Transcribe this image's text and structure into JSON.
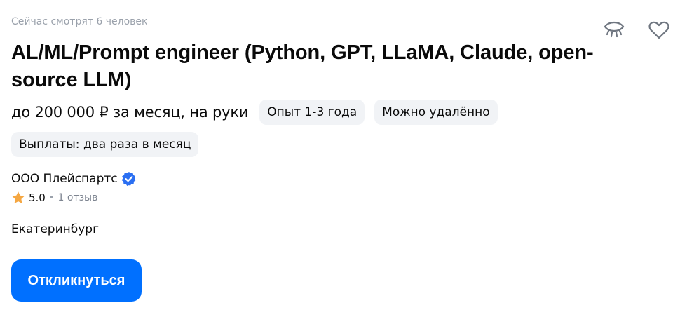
{
  "header": {
    "viewers_text": "Сейчас смотрят 6 человек",
    "title": "AL/ML/Prompt engineer (Python, GPT, LLaMA, Claude, open-source LLM)",
    "icons": [
      "eye-hide-icon",
      "heart-icon"
    ]
  },
  "offer": {
    "salary": "до 200 000 ₽ за месяц, на руки",
    "experience": "Опыт 1-3 года",
    "remote": "Можно удалённо",
    "payouts": "Выплаты: два раза в месяц"
  },
  "company": {
    "name": "ООО Плейспартс",
    "verified_icon": "verified-badge-icon",
    "rating": "5.0",
    "reviews": "1 отзыв"
  },
  "location": {
    "city": "Екатеринбург"
  },
  "actions": {
    "respond_label": "Откликнуться"
  },
  "colors": {
    "accent": "#0070ff",
    "verified": "#2b6ff2",
    "star": "#f5a742",
    "chip_bg": "#f1f3f6",
    "muted_text": "#9aa1ab"
  }
}
